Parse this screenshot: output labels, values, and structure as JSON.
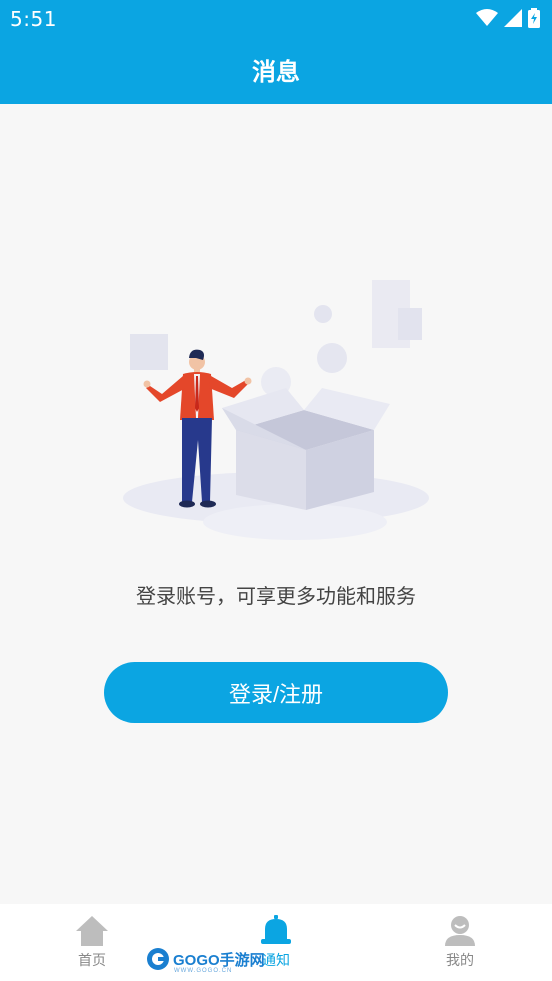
{
  "status_bar": {
    "time": "5:51",
    "icons": [
      "wifi-icon",
      "signal-icon",
      "battery-icon"
    ]
  },
  "header": {
    "title": "消息"
  },
  "empty_state": {
    "illustration": "person-with-open-box",
    "prompt": "登录账号，可享更多功能和服务"
  },
  "login_button": {
    "label": "登录/注册"
  },
  "bottom_nav": {
    "items": [
      {
        "label": "首页",
        "icon": "home-icon",
        "active": false
      },
      {
        "label": "通知",
        "icon": "bell-icon",
        "active": true
      },
      {
        "label": "我的",
        "icon": "user-icon",
        "active": false
      }
    ]
  },
  "watermark": {
    "text": "GOGO手游网",
    "sub": "WWW.GOGO.CN"
  },
  "colors": {
    "primary": "#0ba5e2",
    "inactive": "#888888",
    "background": "#f7f7f7"
  }
}
